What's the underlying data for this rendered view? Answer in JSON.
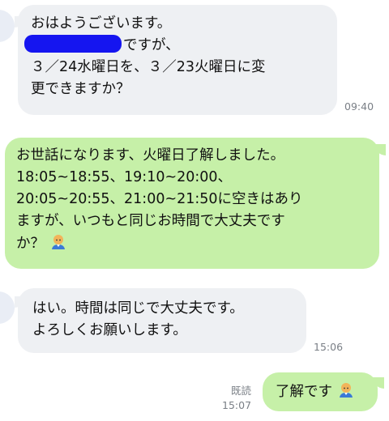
{
  "messages": [
    {
      "side": "received",
      "lines": [
        "おはようございます。",
        "ですが、",
        "３／24水曜日を、３／23火曜日に変",
        "更できますか？"
      ],
      "time": "09:40"
    },
    {
      "side": "sent",
      "lines": [
        "お世話になります、火曜日了解しました。",
        "18:05~18:55、19:10~20:00、",
        "20:05~20:55、21:00~21:50に空きはあり",
        "ますが、いつもと同じお時間で大丈夫です",
        "か？"
      ],
      "icon": "person-emoji-icon"
    },
    {
      "side": "received",
      "lines": [
        "はい。時間は同じで大丈夫です。",
        "よろしくお願いします。"
      ],
      "time": "15:06"
    },
    {
      "side": "sent",
      "lines": [
        "了解です"
      ],
      "icon": "person-emoji-icon",
      "read_label": "既読",
      "time": "15:07"
    }
  ],
  "colors": {
    "received_bubble": "#eef0f3",
    "sent_bubble": "#c6f0a8",
    "redaction": "#1515f0"
  }
}
